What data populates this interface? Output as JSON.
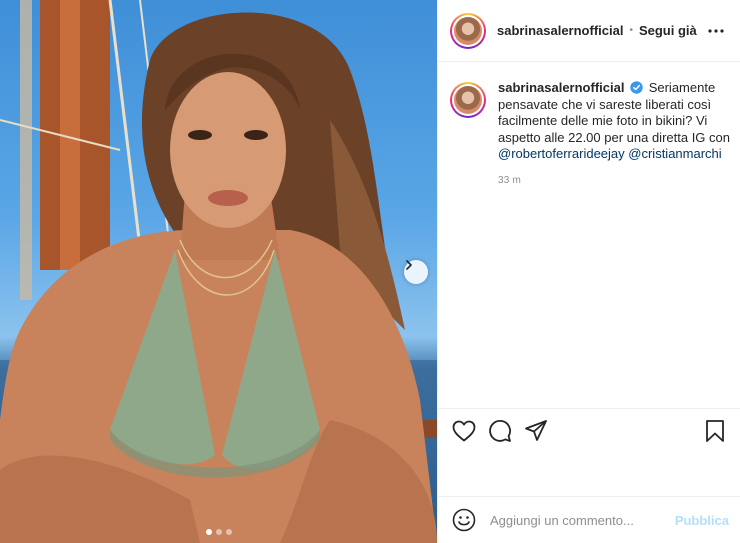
{
  "post": {
    "username": "sabrinasalernofficial",
    "separator": "•",
    "follow_label": "Segui già",
    "caption_text": "Seriamente pensavate che vi sareste liberati così facilmente delle mie foto in bikini? Vi aspetto alle 22.00 per una diretta IG con",
    "mention_1": "@robertoferrarideejay",
    "mention_2": "@cristianmarchi",
    "timestamp": "33 m"
  },
  "carousel": {
    "total": 3,
    "active_index": 0
  },
  "comment": {
    "placeholder": "Aggiungi un commento...",
    "publish_label": "Pubblica"
  },
  "icons": {
    "more": "more-horizontal-icon",
    "verified": "verified-badge-icon",
    "like": "heart-icon",
    "comment": "comment-bubble-icon",
    "share": "send-paper-plane-icon",
    "save": "bookmark-icon",
    "emoji": "emoji-smiley-icon",
    "next": "chevron-right-icon"
  },
  "colors": {
    "verified": "#3897f0",
    "mention": "#00376b",
    "publish": "#b2dffc",
    "muted": "#8e8e8e"
  }
}
